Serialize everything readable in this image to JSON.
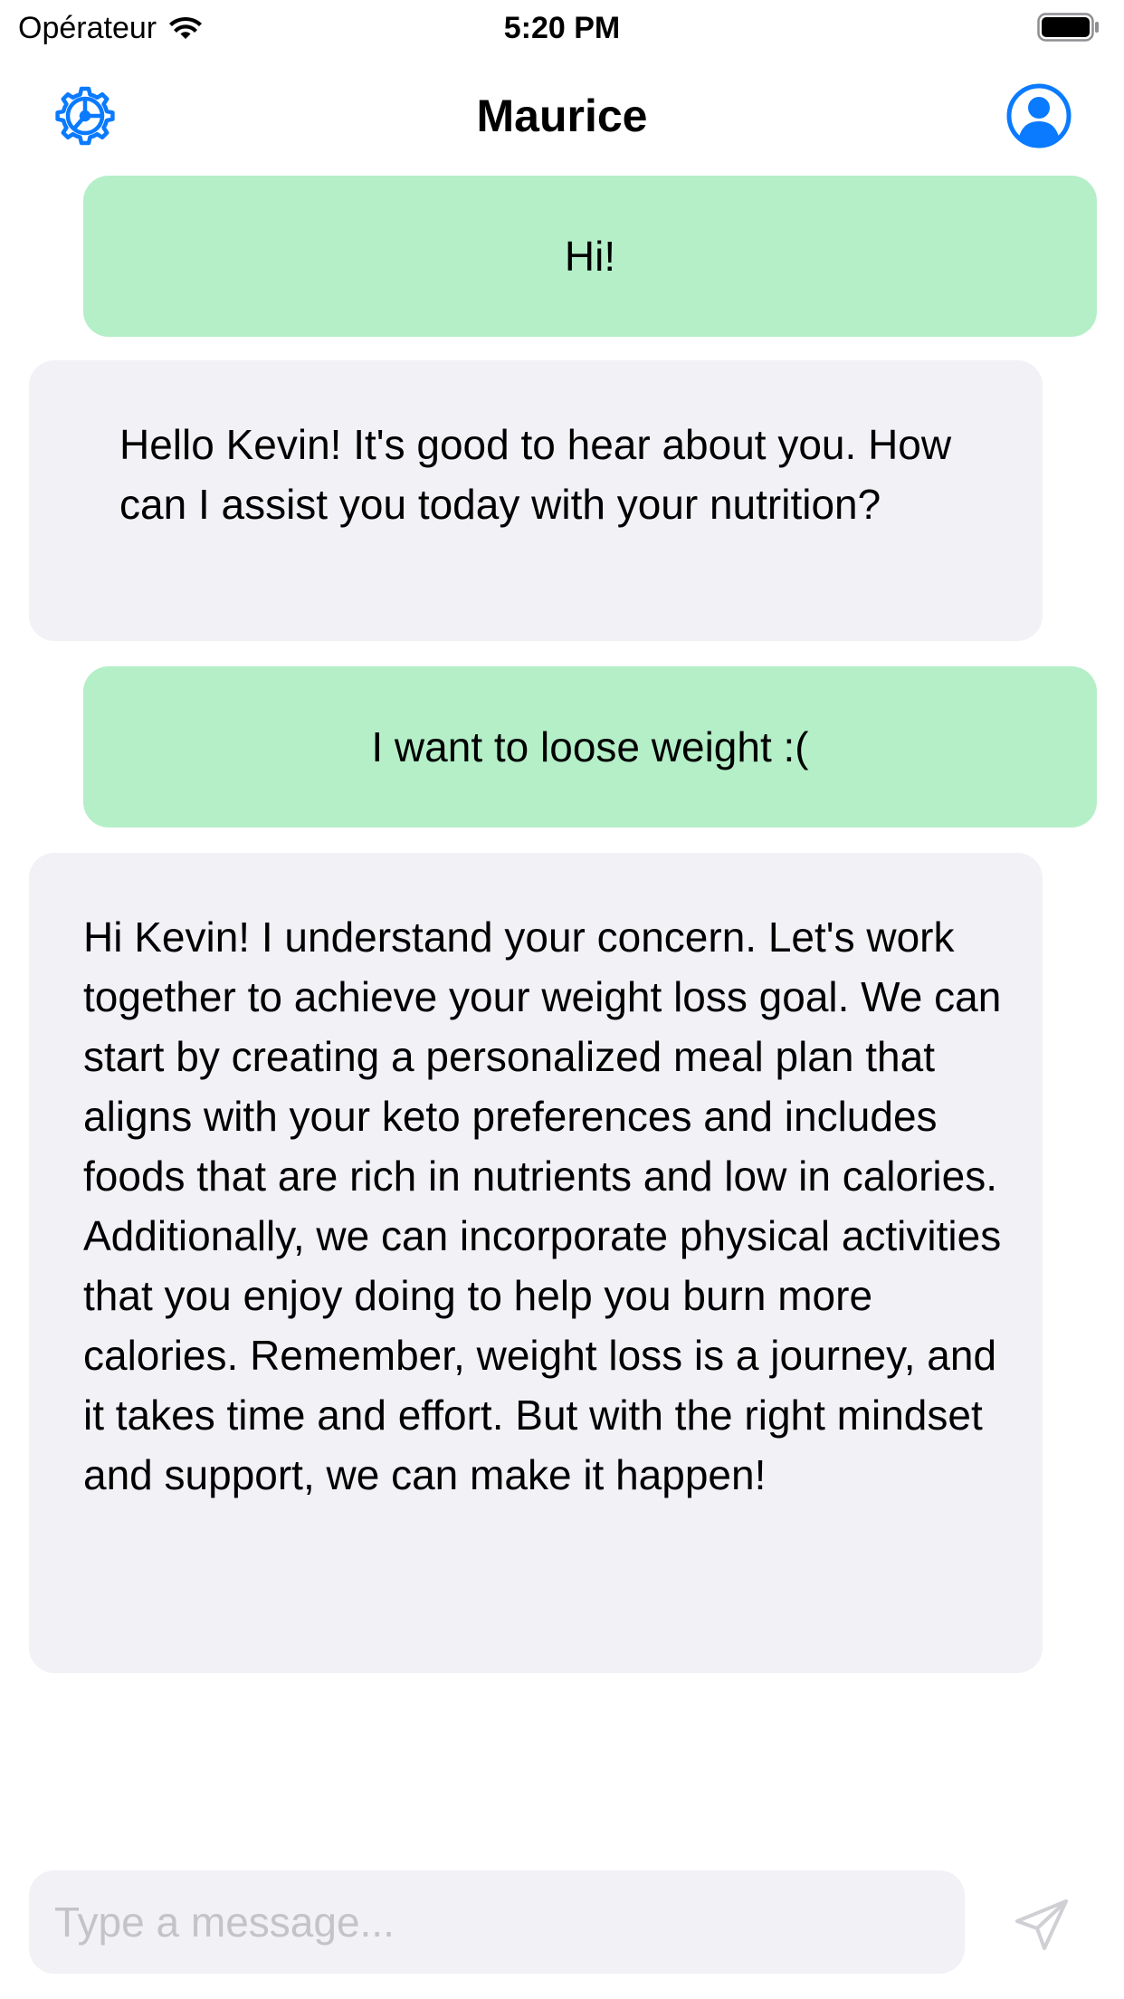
{
  "status_bar": {
    "carrier": "Opérateur",
    "time": "5:20 PM",
    "icons": {
      "signal": "wifi-icon",
      "battery": "battery-icon"
    }
  },
  "nav": {
    "title": "Maurice",
    "left_icon": "settings-gear-icon",
    "right_icon": "profile-icon"
  },
  "messages": [
    {
      "role": "user",
      "text": "Hi!"
    },
    {
      "role": "assistant",
      "text": "Hello Kevin! It's good to hear about you. How can I assist you today with your nutrition?"
    },
    {
      "role": "user",
      "text": "I want to loose weight :("
    },
    {
      "role": "assistant",
      "text": "Hi Kevin! I understand your concern. Let's work together to achieve your weight loss goal. We can start by creating a personalized meal plan that aligns with your keto preferences and includes foods that are rich in nutrients and low in calories. Additionally, we can incorporate physical activities that you enjoy doing to help you burn more calories. Remember, weight loss is a journey, and it takes time and effort. But with the right mindset and support, we can make it happen!"
    }
  ],
  "composer": {
    "value": "",
    "placeholder": "Type a message...",
    "send_icon": "send-icon"
  },
  "colors": {
    "accent": "#0a7aff",
    "user_bubble": "#b4efc8",
    "assistant_bubble": "#f1f1f6",
    "input_background": "#f1f1f6",
    "send_icon_disabled": "#cfcfd4"
  }
}
